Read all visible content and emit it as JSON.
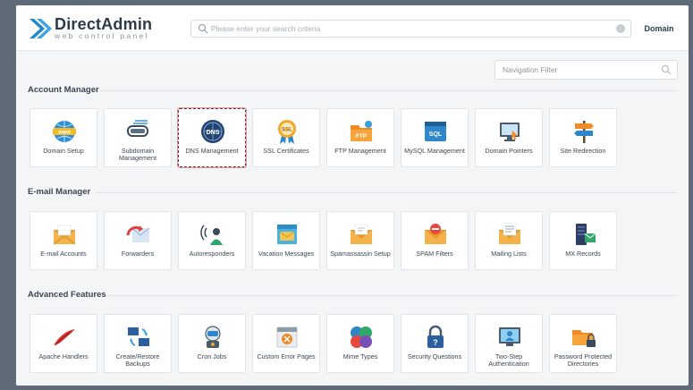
{
  "header": {
    "brand": "DirectAdmin",
    "tagline": "web control panel",
    "search_placeholder": "Please enter your search criteria",
    "domain_label": "Domain"
  },
  "nav_filter": {
    "placeholder": "Navigation Filter"
  },
  "sections": [
    {
      "title": "Account Manager",
      "items": [
        {
          "label": "Domain Setup",
          "icon": "www-globe-icon"
        },
        {
          "label": "Subdomain Management",
          "icon": "subdomain-icon"
        },
        {
          "label": "DNS Management",
          "icon": "dns-globe-icon",
          "selected": true
        },
        {
          "label": "SSL Certificates",
          "icon": "ssl-badge-icon"
        },
        {
          "label": "FTP Management",
          "icon": "ftp-folder-icon"
        },
        {
          "label": "MySQL Management",
          "icon": "mysql-icon"
        },
        {
          "label": "Domain Pointers",
          "icon": "domain-pointer-icon"
        },
        {
          "label": "Site Redirection",
          "icon": "signpost-icon"
        }
      ]
    },
    {
      "title": "E-mail Manager",
      "items": [
        {
          "label": "E-mail Accounts",
          "icon": "envelope-icon"
        },
        {
          "label": "Forwarders",
          "icon": "forward-envelope-icon"
        },
        {
          "label": "Autoresponders",
          "icon": "autoresponder-icon"
        },
        {
          "label": "Vacation Messages",
          "icon": "vacation-icon"
        },
        {
          "label": "Spamassassin Setup",
          "icon": "spamassassin-icon"
        },
        {
          "label": "SPAM Filters",
          "icon": "spam-filter-icon"
        },
        {
          "label": "Mailing Lists",
          "icon": "mailing-list-icon"
        },
        {
          "label": "MX Records",
          "icon": "mx-records-icon"
        }
      ]
    },
    {
      "title": "Advanced Features",
      "items": [
        {
          "label": "Apache Handlers",
          "icon": "apache-feather-icon"
        },
        {
          "label": "Create/Restore Backups",
          "icon": "backup-icon"
        },
        {
          "label": "Cron Jobs",
          "icon": "cron-robot-icon"
        },
        {
          "label": "Custom Error Pages",
          "icon": "error-page-icon"
        },
        {
          "label": "Mime Types",
          "icon": "mime-types-icon"
        },
        {
          "label": "Security Questions",
          "icon": "lock-question-icon"
        },
        {
          "label": "Two-Step Authentication",
          "icon": "two-step-icon"
        },
        {
          "label": "Password Protected Directories",
          "icon": "protected-folder-icon"
        }
      ]
    }
  ],
  "colors": {
    "brand_blue": "#1f86c9",
    "selected_border": "#8b1c22",
    "outer_background": "#5f6b78"
  }
}
